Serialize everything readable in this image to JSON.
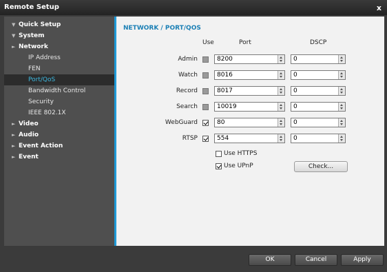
{
  "window": {
    "title": "Remote Setup",
    "close_glyph": "x"
  },
  "sidebar": {
    "items": [
      {
        "label": "Quick Setup",
        "arrow": "▼"
      },
      {
        "label": "System",
        "arrow": "▼"
      },
      {
        "label": "Network",
        "arrow": "►"
      },
      {
        "label": "IP Address"
      },
      {
        "label": "FEN"
      },
      {
        "label": "Port/QoS"
      },
      {
        "label": "Bandwidth Control"
      },
      {
        "label": "Security"
      },
      {
        "label": "IEEE 802.1X"
      },
      {
        "label": "Video",
        "arrow": "►"
      },
      {
        "label": "Audio",
        "arrow": "►"
      },
      {
        "label": "Event Action",
        "arrow": "►"
      },
      {
        "label": "Event",
        "arrow": "►"
      }
    ]
  },
  "main": {
    "title": "NETWORK / PORT/QOS",
    "columns": {
      "use": "Use",
      "port": "Port",
      "dscp": "DSCP"
    },
    "rows": [
      {
        "label": "Admin",
        "use_checked": false,
        "port": "8200",
        "dscp": "0"
      },
      {
        "label": "Watch",
        "use_checked": false,
        "port": "8016",
        "dscp": "0"
      },
      {
        "label": "Record",
        "use_checked": false,
        "port": "8017",
        "dscp": "0"
      },
      {
        "label": "Search",
        "use_checked": false,
        "port": "10019",
        "dscp": "0"
      },
      {
        "label": "WebGuard",
        "use_checked": true,
        "port": "80",
        "dscp": "0"
      },
      {
        "label": "RTSP",
        "use_checked": true,
        "port": "554",
        "dscp": "0"
      }
    ],
    "use_https": {
      "label": "Use HTTPS",
      "checked": false
    },
    "use_upnp": {
      "label": "Use UPnP",
      "checked": true
    },
    "check_button": "Check..."
  },
  "footer": {
    "ok": "OK",
    "cancel": "Cancel",
    "apply": "Apply"
  }
}
